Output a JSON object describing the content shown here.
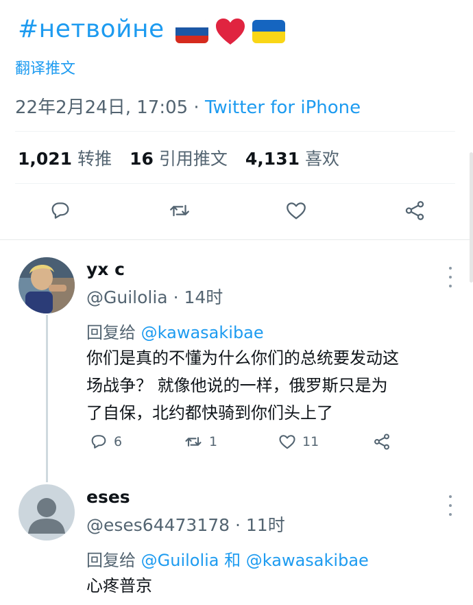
{
  "tweet": {
    "hashtag": "#нетвойне",
    "flags": {
      "russia": [
        "#ffffff",
        "#1c57a5",
        "#d52b1e"
      ],
      "ukraine": [
        "#1565c0",
        "#f9d616"
      ],
      "heart_color": "#e02440"
    },
    "translate_label": "翻译推文",
    "timestamp": "22年2月24日, 17:05 · ",
    "via": "Twitter for iPhone",
    "stats": [
      {
        "count": "1,021",
        "label": "转推"
      },
      {
        "count": "16",
        "label": "引用推文"
      },
      {
        "count": "4,131",
        "label": "喜欢"
      }
    ]
  },
  "replies": [
    {
      "name": "yx c",
      "handle": "@Guilolia · 14时",
      "replying_to_prefix": "回复给 ",
      "replying_to": [
        "@kawasakibae"
      ],
      "replying_joiner": "",
      "text_lines": [
        "你们是真的不懂为什么你们的总统要发动这",
        "场战争？ 就像他说的一样，俄罗斯只是为",
        "了自保，北约都快骑到你们头上了"
      ],
      "counts": {
        "replies": "6",
        "retweets": "1",
        "likes": "11"
      }
    },
    {
      "name": "eses",
      "handle": "@eses64473178 · 11时",
      "replying_to_prefix": "回复给 ",
      "replying_to": [
        "@Guilolia",
        "@kawasakibae"
      ],
      "replying_joiner": " 和 ",
      "text_lines": [
        "心疼普京"
      ]
    }
  ],
  "colors": {
    "accent": "#1d9bf0",
    "muted": "#536471",
    "text": "#0f1419"
  },
  "icons": [
    "reply-icon",
    "retweet-icon",
    "like-icon",
    "share-icon",
    "more-icon"
  ]
}
